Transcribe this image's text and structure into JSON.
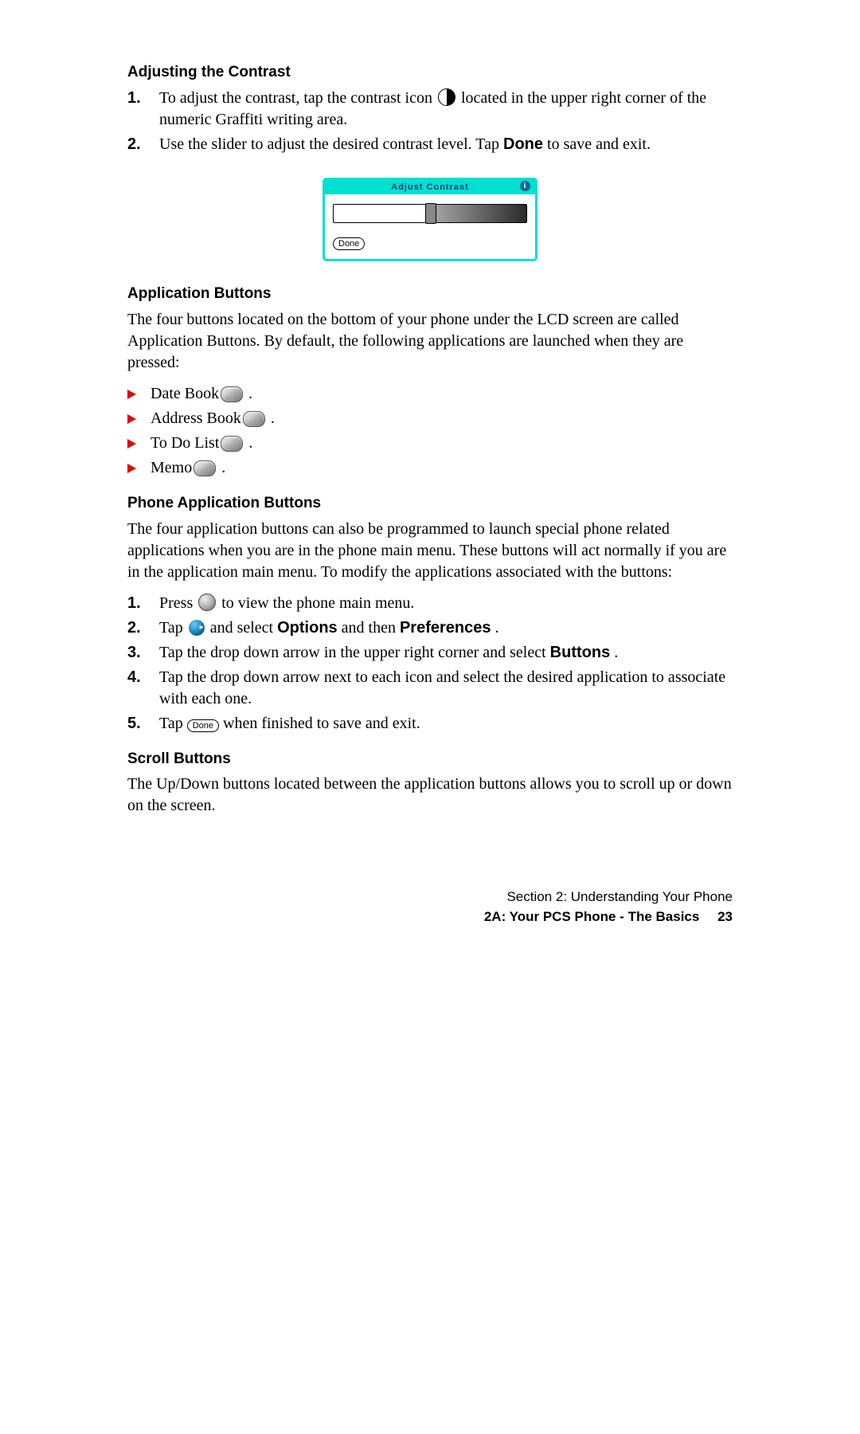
{
  "s1": {
    "title": "Adjusting the Contrast",
    "i1_a": "To adjust the contrast, tap the contrast icon ",
    "i1_b": " located in the upper right corner of the numeric Graffiti writing area.",
    "i2_a": "Use the slider to adjust the desired contrast level. Tap ",
    "i2_bold": "Done",
    "i2_b": " to save and exit."
  },
  "dlg": {
    "title": "Adjust Contrast",
    "done": "Done"
  },
  "s2": {
    "title": "Application Buttons",
    "intro": "The four buttons located on the bottom of your phone under the LCD screen are called Application Buttons. By default, the following applications are launched when they are pressed:",
    "items": [
      "Date Book ",
      "Address Book ",
      "To Do List ",
      "Memo "
    ]
  },
  "s3": {
    "title": "Phone Application Buttons",
    "intro": "The four application buttons can also be programmed to launch special phone related applications when you are in the phone main menu. These buttons will act normally if you are in the application main menu. To modify the applications associated with the buttons:",
    "i1_a": "Press ",
    "i1_b": " to view the phone main menu.",
    "i2_a": "Tap ",
    "i2_b": " and select ",
    "i2_opt": "Options",
    "i2_c": " and then ",
    "i2_pref": "Preferences",
    "i2_d": ".",
    "i3_a": "Tap the drop down arrow in the upper right corner and select ",
    "i3_btn": "Buttons",
    "i3_b": ".",
    "i4": "Tap the drop down arrow next to each icon and select the desired application to associate with each one.",
    "i5_a": "Tap ",
    "i5_done": "Done",
    "i5_b": " when finished to save and exit."
  },
  "s4": {
    "title": "Scroll Buttons",
    "body": "The Up/Down buttons located between the application buttons allows you to scroll up or down on the screen."
  },
  "footer": {
    "line1": "Section 2: Understanding Your Phone",
    "line2": "2A: Your PCS Phone - The Basics",
    "page": "23"
  },
  "nums": [
    "1.",
    "2.",
    "3.",
    "4.",
    "5."
  ]
}
